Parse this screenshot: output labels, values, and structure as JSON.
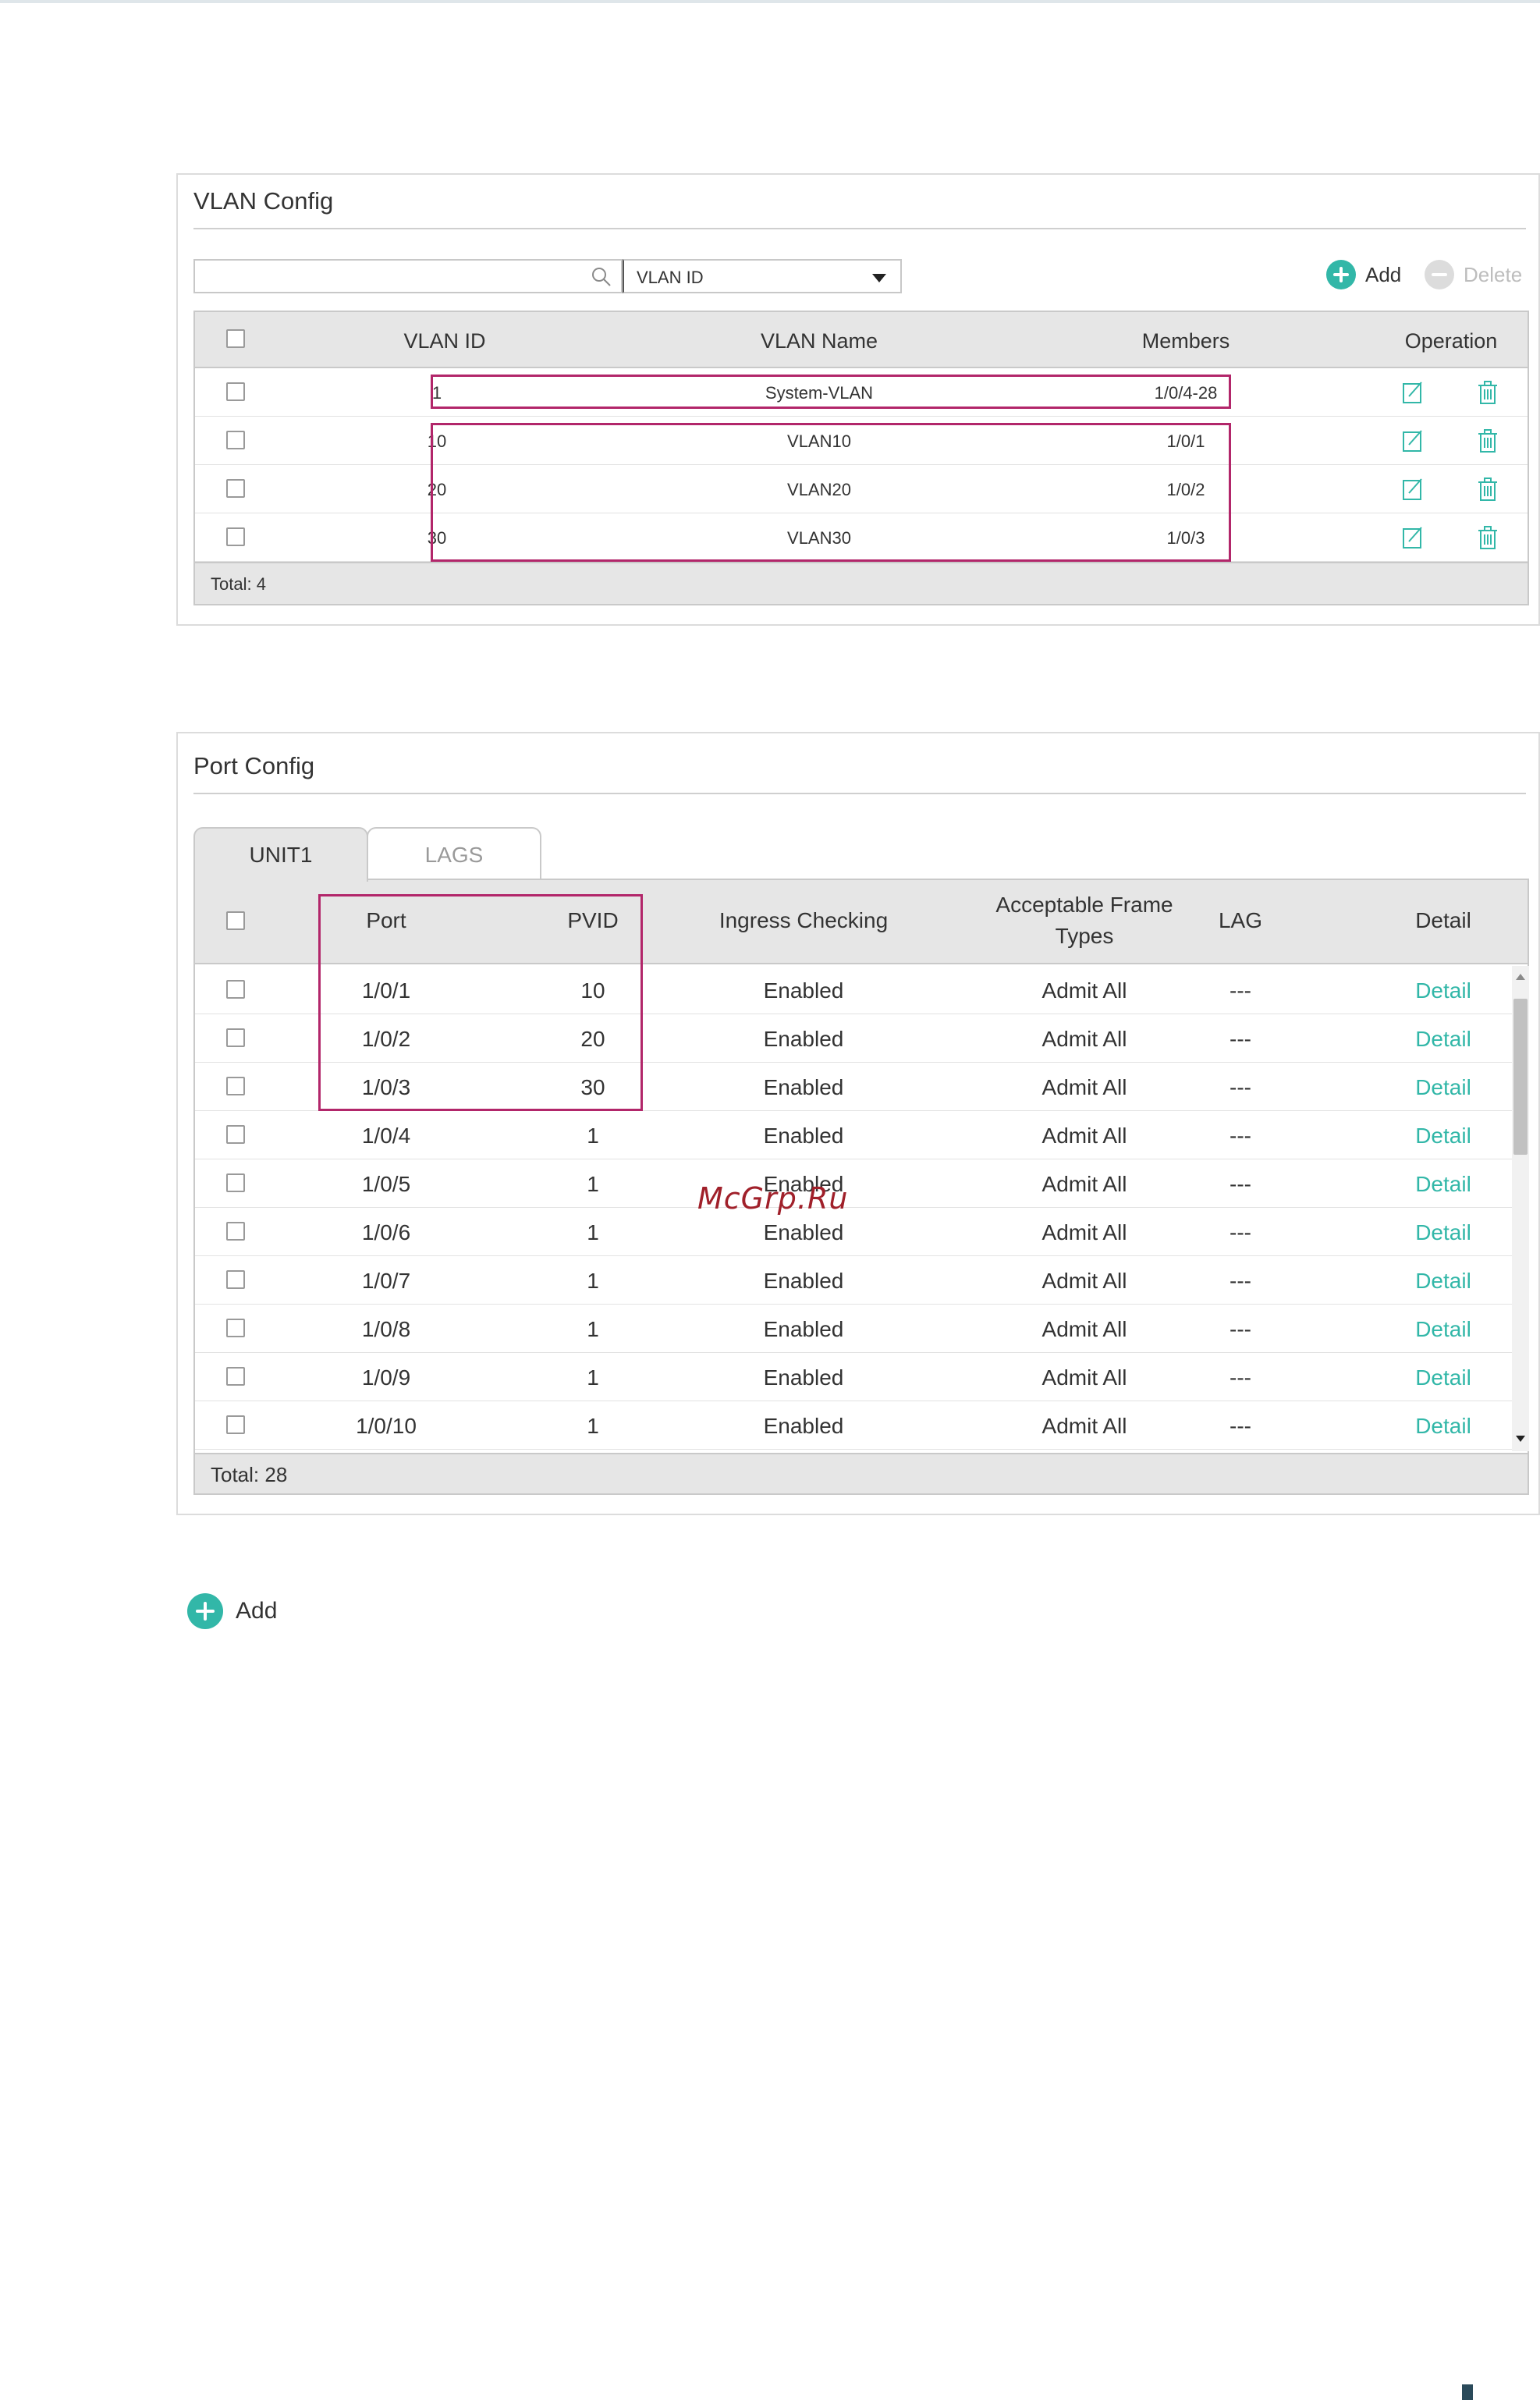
{
  "vlan_config": {
    "title": "VLAN Config",
    "search": {
      "value": ""
    },
    "filter": {
      "selected": "VLAN ID"
    },
    "toolbar": {
      "add_label": "Add",
      "delete_label": "Delete"
    },
    "columns": [
      "VLAN ID",
      "VLAN Name",
      "Members",
      "Operation"
    ],
    "rows": [
      {
        "vlan_id": "1",
        "name": "System-VLAN",
        "members": "1/0/4-28"
      },
      {
        "vlan_id": "10",
        "name": "VLAN10",
        "members": "1/0/1"
      },
      {
        "vlan_id": "20",
        "name": "VLAN20",
        "members": "1/0/2"
      },
      {
        "vlan_id": "30",
        "name": "VLAN30",
        "members": "1/0/3"
      }
    ],
    "total": "Total: 4"
  },
  "port_config": {
    "title": "Port Config",
    "tabs": [
      "UNIT1",
      "LAGS"
    ],
    "columns": {
      "port": "Port",
      "pvid": "PVID",
      "ingress": "Ingress Checking",
      "frame_line1": "Acceptable Frame",
      "frame_line2": "Types",
      "lag": "LAG",
      "detail": "Detail"
    },
    "rows": [
      {
        "port": "1/0/1",
        "pvid": "10",
        "ingress": "Enabled",
        "frame": "Admit All",
        "lag": "---",
        "detail": "Detail"
      },
      {
        "port": "1/0/2",
        "pvid": "20",
        "ingress": "Enabled",
        "frame": "Admit All",
        "lag": "---",
        "detail": "Detail"
      },
      {
        "port": "1/0/3",
        "pvid": "30",
        "ingress": "Enabled",
        "frame": "Admit All",
        "lag": "---",
        "detail": "Detail"
      },
      {
        "port": "1/0/4",
        "pvid": "1",
        "ingress": "Enabled",
        "frame": "Admit All",
        "lag": "---",
        "detail": "Detail"
      },
      {
        "port": "1/0/5",
        "pvid": "1",
        "ingress": "Enabled",
        "frame": "Admit All",
        "lag": "---",
        "detail": "Detail"
      },
      {
        "port": "1/0/6",
        "pvid": "1",
        "ingress": "Enabled",
        "frame": "Admit All",
        "lag": "---",
        "detail": "Detail"
      },
      {
        "port": "1/0/7",
        "pvid": "1",
        "ingress": "Enabled",
        "frame": "Admit All",
        "lag": "---",
        "detail": "Detail"
      },
      {
        "port": "1/0/8",
        "pvid": "1",
        "ingress": "Enabled",
        "frame": "Admit All",
        "lag": "---",
        "detail": "Detail"
      },
      {
        "port": "1/0/9",
        "pvid": "1",
        "ingress": "Enabled",
        "frame": "Admit All",
        "lag": "---",
        "detail": "Detail"
      },
      {
        "port": "1/0/10",
        "pvid": "1",
        "ingress": "Enabled",
        "frame": "Admit All",
        "lag": "---",
        "detail": "Detail"
      }
    ],
    "total": "Total: 28"
  },
  "bottom": {
    "add_label": "Add"
  },
  "watermark": "McGrp.Ru",
  "colors": {
    "accent": "#32b7a8",
    "highlight": "#b2266a",
    "header_bg": "#e6e6e6"
  },
  "icons": {
    "search": "search-icon",
    "edit": "edit-icon",
    "delete": "trash-icon",
    "add": "plus-circle-icon"
  }
}
